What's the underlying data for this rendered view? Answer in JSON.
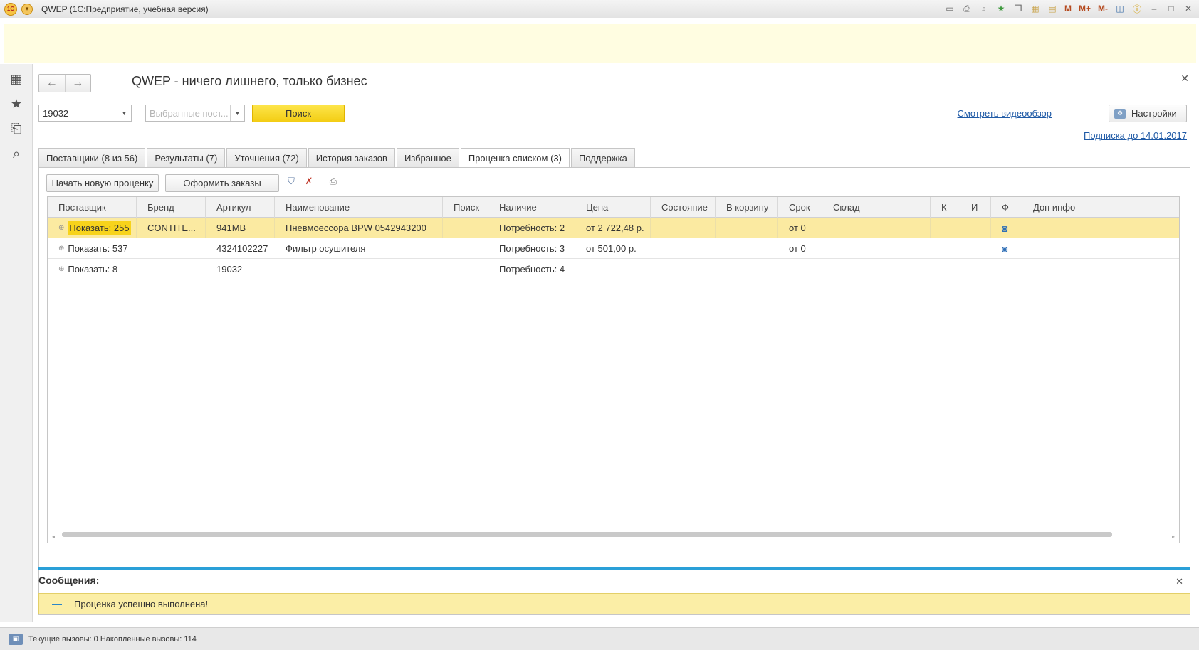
{
  "window": {
    "title": "QWEP  (1С:Предприятие, учебная версия)",
    "icons": [
      "save-icon",
      "print-icon",
      "preview-icon",
      "favorite-add-icon",
      "copy-icon",
      "calculator-icon",
      "calendar-icon",
      "memory-icon",
      "panel-icon",
      "info-icon",
      "minimize-icon",
      "maximize-icon",
      "close-icon"
    ],
    "memory_buttons": [
      "M",
      "M+",
      "M-"
    ]
  },
  "leftpanel": {
    "icons": [
      "apps-grid-icon",
      "star-icon",
      "history-icon",
      "search-icon"
    ]
  },
  "form": {
    "title": "QWEP - ничего лишнего, только бизнес",
    "search_value": "19032",
    "suppliers_placeholder": "Выбранные пост...",
    "search_button": "Поиск",
    "video_link": "Смотреть видеообзор",
    "settings_button": "Настройки",
    "subscription_link": "Подписка до 14.01.2017"
  },
  "tabs": [
    {
      "label": "Поставщики (8 из 56)"
    },
    {
      "label": "Результаты (7)"
    },
    {
      "label": "Уточнения (72)"
    },
    {
      "label": "История заказов"
    },
    {
      "label": "Избранное"
    },
    {
      "label": "Проценка  списком (3)"
    },
    {
      "label": "Поддержка"
    }
  ],
  "toolbar": {
    "new_pricing": "Начать новую проценку",
    "make_orders": "Оформить заказы"
  },
  "grid": {
    "columns": [
      "Поставщик",
      "Бренд",
      "Артикул",
      "Наименование",
      "Поиск",
      "Наличие",
      "Цена",
      "Состояние",
      "В корзину",
      "Срок",
      "Склад",
      "К",
      "И",
      "Ф",
      "Доп инфо"
    ],
    "rows": [
      {
        "supplier": "Показать: 255",
        "brand": "CONTITE...",
        "article": "941MB",
        "name": "Пневмоессора BPW 0542943200",
        "search": "",
        "availability": "Потребность: 2",
        "price": "от 2 722,48 р.",
        "state": "",
        "cart": "",
        "term": "от 0",
        "warehouse": "",
        "k": "",
        "i": "",
        "photo": "camera-icon",
        "extra": ""
      },
      {
        "supplier": "Показать: 537",
        "brand": "",
        "article": "4324102227",
        "name": "Фильтр осушителя",
        "search": "",
        "availability": "Потребность: 3",
        "price": "от 501,00 р.",
        "state": "",
        "cart": "",
        "term": "от 0",
        "warehouse": "",
        "k": "",
        "i": "",
        "photo": "camera-icon",
        "extra": ""
      },
      {
        "supplier": "Показать: 8",
        "brand": "",
        "article": "19032",
        "name": "",
        "search": "",
        "availability": "Потребность: 4",
        "price": "",
        "state": "",
        "cart": "",
        "term": "",
        "warehouse": "",
        "k": "",
        "i": "",
        "photo": "",
        "extra": ""
      }
    ]
  },
  "messages": {
    "title": "Сообщения:",
    "text": "Проценка успешно выполнена!"
  },
  "status": {
    "text": "Текущие вызовы: 0   Накопленные вызовы: 114"
  },
  "colors": {
    "accent_yellow": "#f7d31b",
    "selected_row": "#fbeaa1",
    "link": "#1f5aa6",
    "message_bar": "#2aa0d8"
  }
}
